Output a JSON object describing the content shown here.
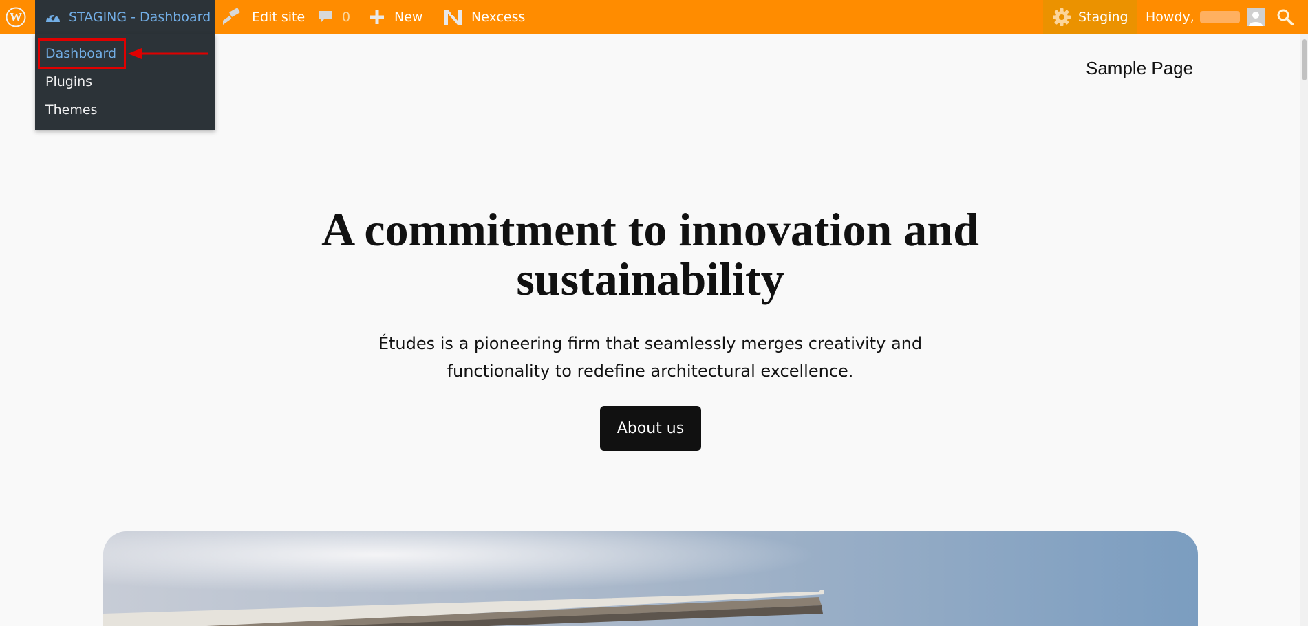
{
  "admin_bar": {
    "site_name": "STAGING - Dashboard",
    "edit_site": "Edit site",
    "comments_count": "0",
    "new_label": "New",
    "nexcess_label": "Nexcess",
    "staging_label": "Staging",
    "howdy": "Howdy,",
    "colors": {
      "bar": "#ff8c00",
      "dark": "#2c3338",
      "link": "#72aee6"
    }
  },
  "site_menu": {
    "items": [
      {
        "label": "Dashboard"
      },
      {
        "label": "Plugins"
      },
      {
        "label": "Themes"
      }
    ]
  },
  "page": {
    "nav_link": "Sample Page",
    "hero_title": "A commitment to innovation and sustainability",
    "hero_description": "Études is a pioneering firm that seamlessly merges creativity and functionality to redefine architectural excellence.",
    "cta_label": "About us"
  },
  "icons": [
    "wordpress-logo-icon",
    "dashboard-gauge-icon",
    "edit-site-hammer-icon",
    "comment-bubble-icon",
    "plus-icon",
    "nexcess-logo-icon",
    "gear-icon",
    "user-avatar-icon",
    "search-icon"
  ],
  "annotation": {
    "highlight_color": "#e00000"
  }
}
